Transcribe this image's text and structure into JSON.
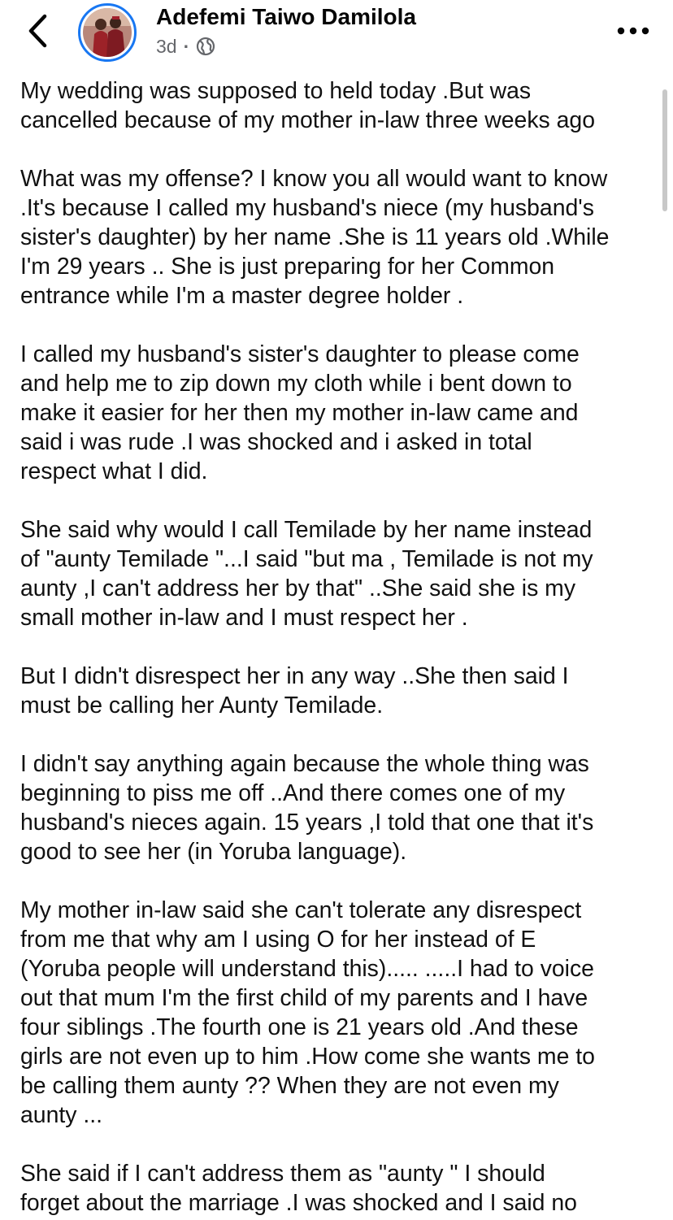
{
  "post": {
    "author": "Adefemi Taiwo Damilola",
    "time": "3d",
    "separator": "·",
    "audience_icon": "globe-icon",
    "paragraphs": [
      "My wedding was supposed to held today .But was\ncancelled because of my mother in-law three weeks ago",
      "What was my offense? I know you all would want to know\n.It's because I called my husband's niece (my husband's\nsister's daughter) by her name .She is 11 years old .While\nI'm 29 years .. She is just preparing for her Common\nentrance while I'm a master degree holder .",
      "I called my husband's sister's daughter to please come\nand help me to zip down my cloth while i bent down to\nmake it easier for her then   my mother in-law came and\nsaid i was rude .I was shocked and i asked in total\nrespect what I did.",
      "She said why would I call Temilade by her name instead\nof \"aunty Temilade \"...I said \"but ma , Temilade is not my\naunty ,I can't address her by that\" ..She said she is my\nsmall mother in-law and I must respect her .",
      "But I didn't disrespect her in any way ..She then said I\nmust be calling her Aunty Temilade.",
      "I didn't say anything again because the whole thing was\nbeginning to piss me off ..And there comes one of my\nhusband's nieces again. 15 years ,I told that one that it's\ngood to see her (in Yoruba language).",
      "My mother in-law said she can't tolerate any disrespect\nfrom me that  why am I using O for her instead of E\n(Yoruba people will understand this)..... .....I had to voice\nout that mum I'm the first child of my parents and I have\nfour siblings .The fourth one is 21 years old .And these\ngirls are not even up to him .How come she wants me to\nbe calling them aunty ?? When they are not even my\naunty ...",
      "She said if I can't address them as \"aunty \" I should\nforget about the marriage .I was shocked and I said no"
    ]
  },
  "icons": {
    "back": "chevron-left-icon",
    "more": "more-horizontal-icon"
  },
  "colors": {
    "accent": "#1877f2",
    "text": "#111111",
    "meta": "#65676b"
  }
}
